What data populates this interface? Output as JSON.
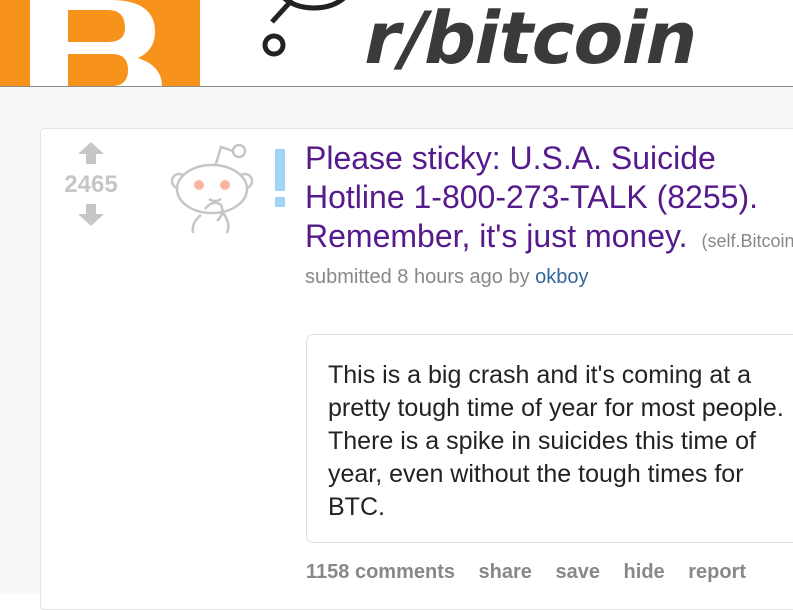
{
  "header": {
    "subreddit": "r/bitcoin"
  },
  "post": {
    "score": "2465",
    "title": "Please sticky: U.S.A. Suicide Hotline 1-800-273-TALK (8255). Remember, it's just money.",
    "domain": "(self.Bitcoin)",
    "tagline": {
      "prefix": "submitted 8 hours ago by",
      "author": "okboy"
    },
    "body": "This is a big crash and it's coming at a pretty tough time of year for most people. There is a spike in suicides this time of year, even without the tough times for BTC.",
    "buttons": {
      "comments": "1158 comments",
      "share": "share",
      "save": "save",
      "hide": "hide",
      "report": "report"
    }
  },
  "colors": {
    "brand_orange": "#f7931a",
    "title_visited": "#551a8b",
    "author_link": "#336699",
    "muted": "#888888",
    "self_post_icon": "#9fd4f2"
  },
  "icons": {
    "upvote": "upvote-arrow-icon",
    "downvote": "downvote-arrow-icon",
    "thumbnail": "snoo-thinking-icon",
    "self_post": "exclamation-icon",
    "logo": "bitcoin-b-logo"
  }
}
